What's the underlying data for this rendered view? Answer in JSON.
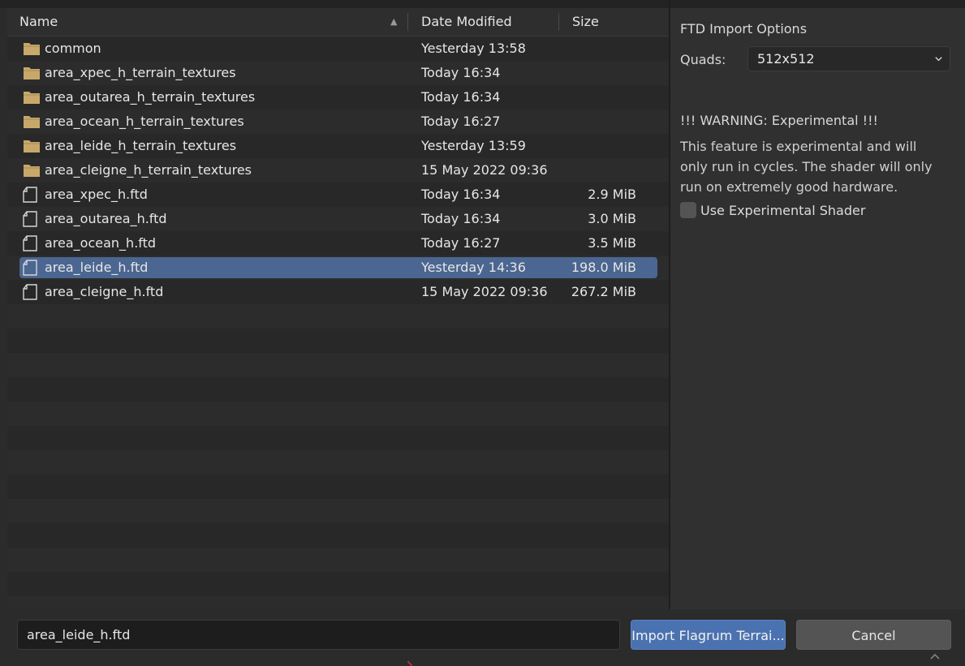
{
  "header": {
    "name_label": "Name",
    "date_label": "Date Modified",
    "size_label": "Size",
    "sort_indicator": "▲"
  },
  "files": [
    {
      "type": "folder",
      "name": "common",
      "date": "Yesterday 13:58",
      "size": ""
    },
    {
      "type": "folder",
      "name": "area_xpec_h_terrain_textures",
      "date": "Today 16:34",
      "size": ""
    },
    {
      "type": "folder",
      "name": "area_outarea_h_terrain_textures",
      "date": "Today 16:34",
      "size": ""
    },
    {
      "type": "folder",
      "name": "area_ocean_h_terrain_textures",
      "date": "Today 16:27",
      "size": ""
    },
    {
      "type": "folder",
      "name": "area_leide_h_terrain_textures",
      "date": "Yesterday 13:59",
      "size": ""
    },
    {
      "type": "folder",
      "name": "area_cleigne_h_terrain_textures",
      "date": "15 May 2022 09:36",
      "size": ""
    },
    {
      "type": "file",
      "name": "area_xpec_h.ftd",
      "date": "Today 16:34",
      "size": "2.9 MiB"
    },
    {
      "type": "file",
      "name": "area_outarea_h.ftd",
      "date": "Today 16:34",
      "size": "3.0 MiB"
    },
    {
      "type": "file",
      "name": "area_ocean_h.ftd",
      "date": "Today 16:27",
      "size": "3.5 MiB"
    },
    {
      "type": "file",
      "name": "area_leide_h.ftd",
      "date": "Yesterday 14:36",
      "size": "198.0 MiB",
      "selected": true
    },
    {
      "type": "file",
      "name": "area_cleigne_h.ftd",
      "date": "15 May 2022 09:36",
      "size": "267.2 MiB"
    }
  ],
  "options": {
    "title": "FTD Import Options",
    "quads_label": "Quads:",
    "quads_value": "512x512",
    "warning": "!!! WARNING: Experimental !!!",
    "description_lines": [
      "This feature is experimental and will",
      "only run in cycles. The shader will only",
      "run on extremely good hardware."
    ],
    "checkbox_label": "Use Experimental Shader",
    "checkbox_checked": false
  },
  "bottom": {
    "filename_value": "area_leide_h.ftd",
    "import_button": "Import Flagrum Terrai...",
    "cancel_button": "Cancel"
  },
  "colors": {
    "folder_icon": "#c8a86a",
    "selected_row": "#4b6691",
    "accent_button": "#4a72b0"
  },
  "icons": {
    "folder": "folder-icon",
    "file": "file-icon",
    "dropdown": "chevron-down-icon",
    "resize": "chevron-up-icon"
  }
}
